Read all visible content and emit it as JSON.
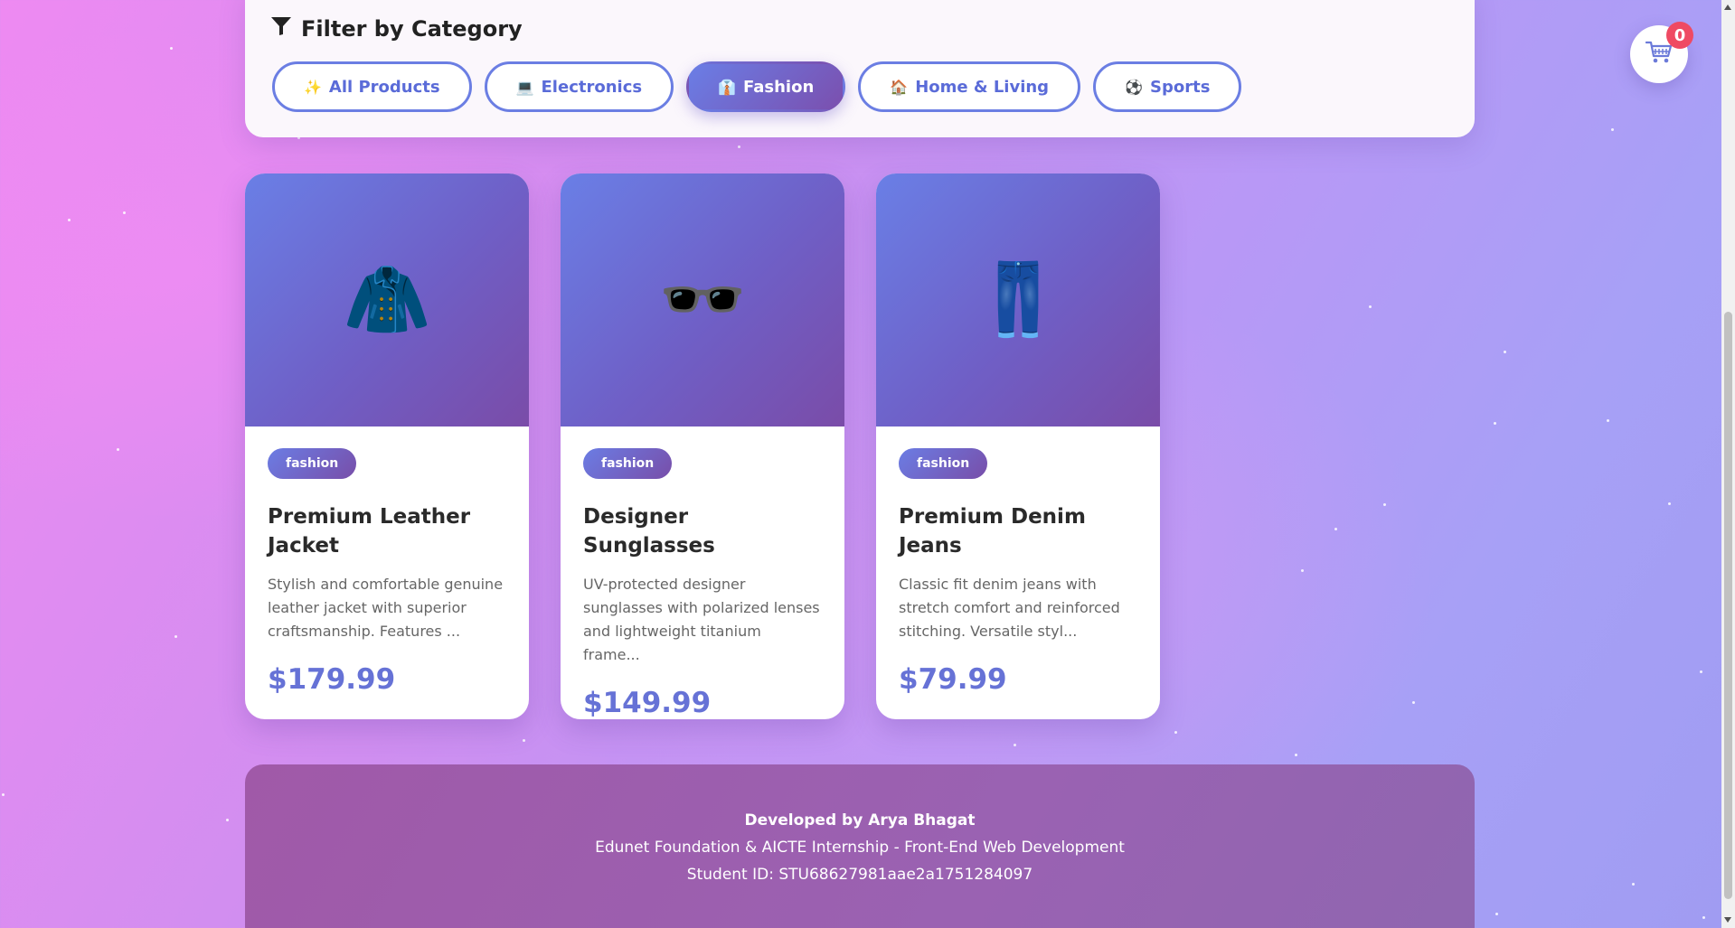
{
  "filter": {
    "title": "Filter by Category",
    "icon": "funnel-icon",
    "buttons": [
      {
        "emoji": "✨",
        "label": "All Products",
        "active": false
      },
      {
        "emoji": "💻",
        "label": "Electronics",
        "active": false
      },
      {
        "emoji": "👔",
        "label": "Fashion",
        "active": true
      },
      {
        "emoji": "🏠",
        "label": "Home & Living",
        "active": false
      },
      {
        "emoji": "⚽",
        "label": "Sports",
        "active": false
      }
    ]
  },
  "cart": {
    "icon": "shopping-cart-icon",
    "count": "0"
  },
  "products": [
    {
      "emoji": "🧥",
      "category": "fashion",
      "name": "Premium Leather Jacket",
      "description": "Stylish and comfortable genuine leather jacket with superior craftsmanship. Features ...",
      "price": "$179.99"
    },
    {
      "emoji": "🕶️",
      "category": "fashion",
      "name": "Designer Sunglasses",
      "description": "UV-protected designer sunglasses with polarized lenses and lightweight titanium frame...",
      "price": "$149.99"
    },
    {
      "emoji": "👖",
      "category": "fashion",
      "name": "Premium Denim Jeans",
      "description": "Classic fit denim jeans with stretch comfort and reinforced stitching. Versatile styl...",
      "price": "$79.99"
    }
  ],
  "footer": {
    "developer": "Developed by Arya Bhagat",
    "internship": "Edunet Foundation & AICTE Internship - Front-End Web Development",
    "student_id": "Student ID: STU68627981aae2a1751284097"
  },
  "colors": {
    "accent": "#6672d6",
    "gradient_start": "#6a7fe6",
    "gradient_end": "#7a4ca8",
    "badge": "#ef4a63"
  }
}
